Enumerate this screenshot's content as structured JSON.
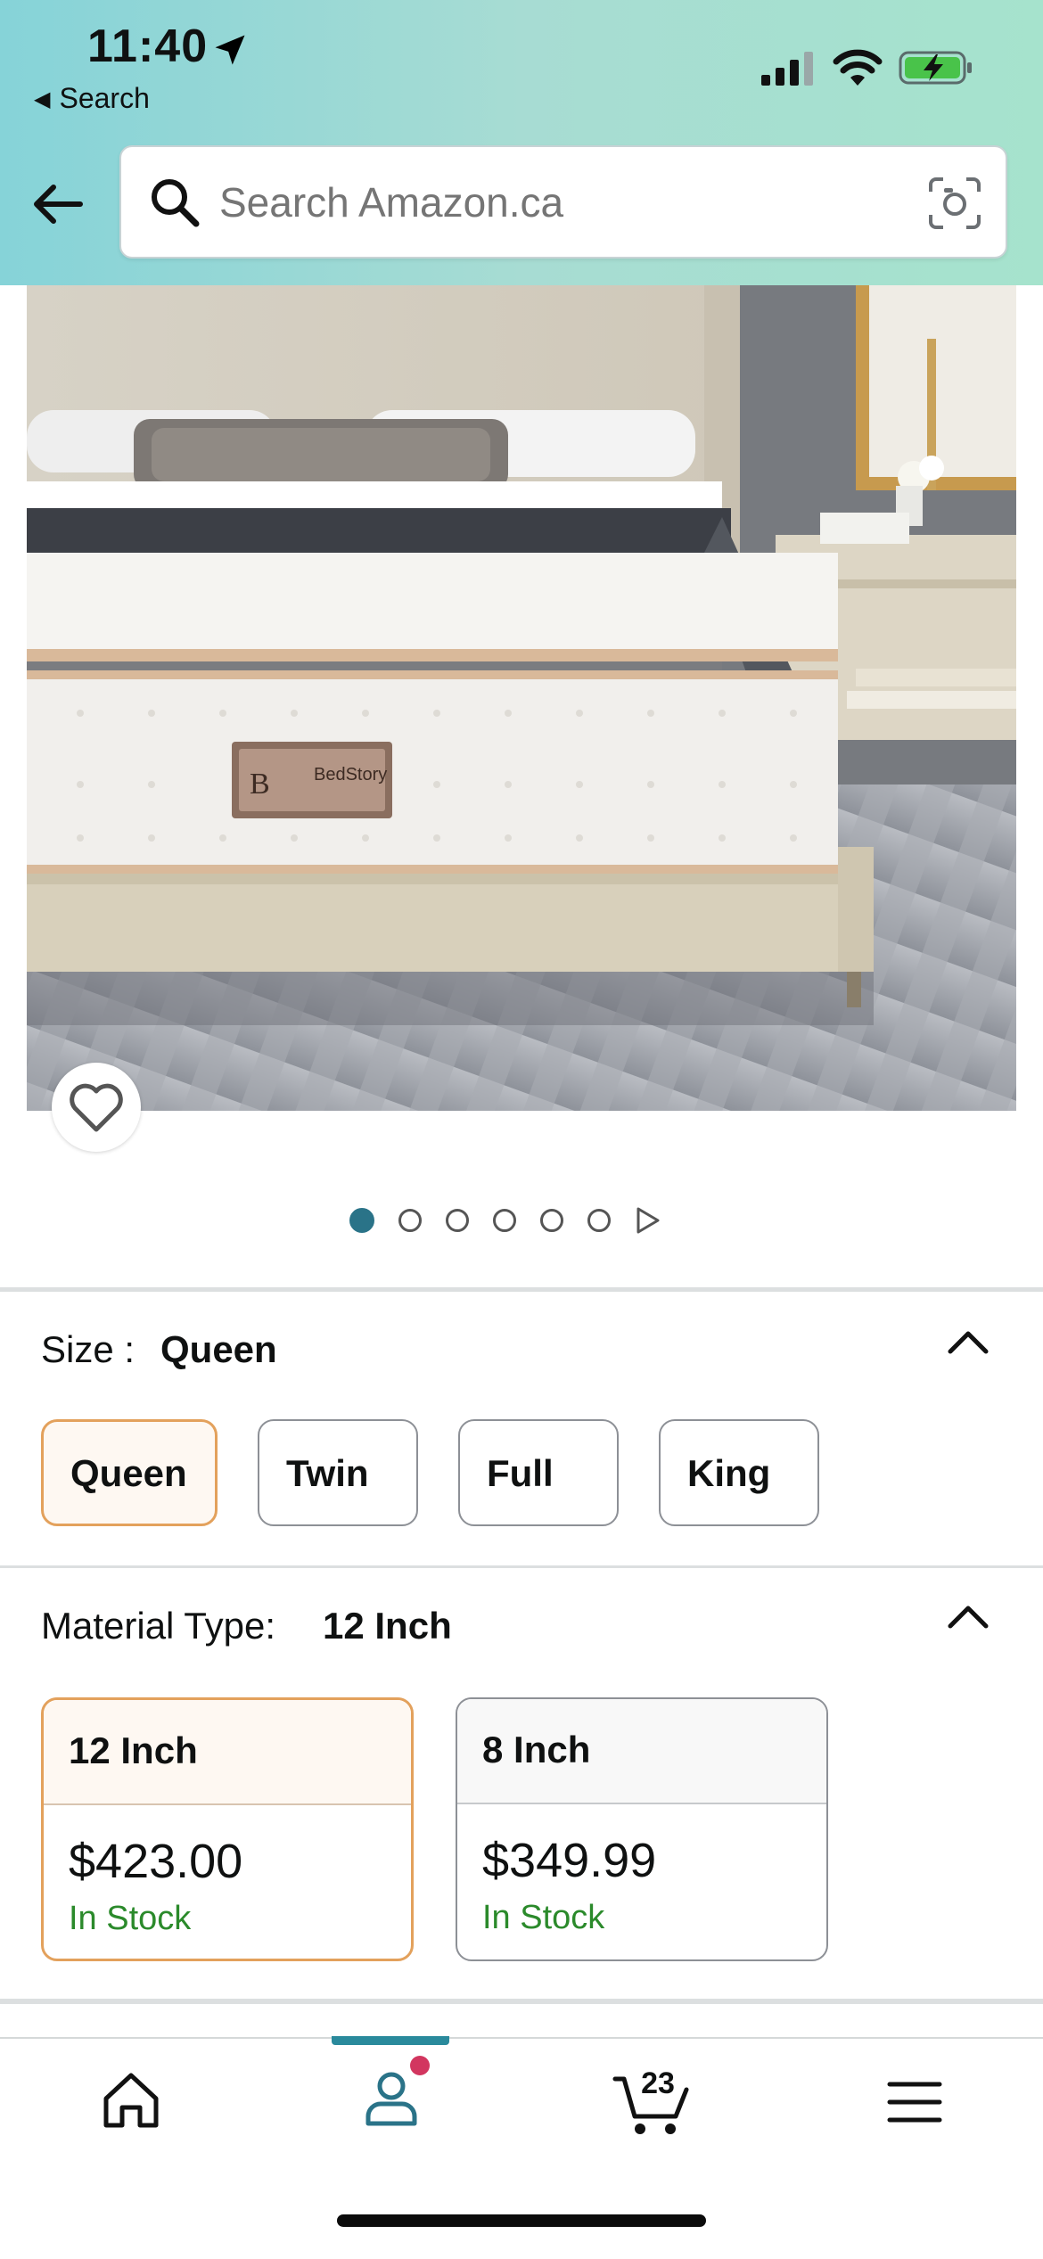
{
  "status_bar": {
    "time": "11:40",
    "back_app": "Search"
  },
  "search": {
    "placeholder": "Search Amazon.ca"
  },
  "product_image": {
    "brand_label": "BedStory"
  },
  "carousel": {
    "total_dots": 6,
    "active_index": 0
  },
  "size": {
    "label": "Size :",
    "selected": "Queen",
    "options": [
      "Queen",
      "Twin",
      "Full",
      "King"
    ]
  },
  "material": {
    "label": "Material Type:",
    "selected": "12 Inch",
    "options": [
      {
        "name": "12 Inch",
        "price": "$423.00",
        "stock": "In Stock"
      },
      {
        "name": "8 Inch",
        "price": "$349.99",
        "stock": "In Stock"
      }
    ]
  },
  "bottom_nav": {
    "cart_count": "23",
    "items": [
      "home-icon",
      "account-icon",
      "cart-icon",
      "menu-icon"
    ]
  },
  "colors": {
    "accent_teal": "#2a7388",
    "selected_border": "#e3a15c",
    "in_stock_green": "#2b8a2b"
  }
}
